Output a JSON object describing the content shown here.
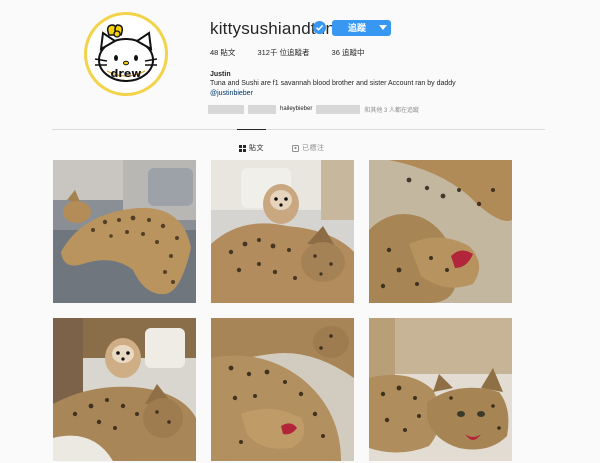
{
  "profile": {
    "username": "kittysushiandtuna",
    "follow_label": "追蹤",
    "posts": "48 貼文",
    "followers": "312千 位追蹤者",
    "following": "36 追蹤中",
    "full_name": "Justin",
    "bio": "Tuna and Sushi are f1 savannah blood brother and sister Account ran by daddy",
    "bio_link": "@justinbieber",
    "followed_by_name": "haileybieber",
    "followed_by_suffix": "和其他 3 人都在追蹤"
  },
  "avatar": {
    "text": "drew"
  },
  "tabs": [
    {
      "label": "貼文",
      "icon": "grid-icon"
    },
    {
      "label": "已標注",
      "icon": "tag-icon"
    }
  ],
  "colors": {
    "accent": "#3897f0",
    "avatar_ring": "#f2d34a",
    "text": "#262626",
    "muted": "#8e8e8e"
  },
  "posts_grid": [
    {
      "name": "post-1",
      "subject": "cat"
    },
    {
      "name": "post-2",
      "subject": "dog-and-cat"
    },
    {
      "name": "post-3",
      "subject": "cats"
    },
    {
      "name": "post-4",
      "subject": "dog-and-cat"
    },
    {
      "name": "post-5",
      "subject": "cats"
    },
    {
      "name": "post-6",
      "subject": "cats"
    }
  ]
}
